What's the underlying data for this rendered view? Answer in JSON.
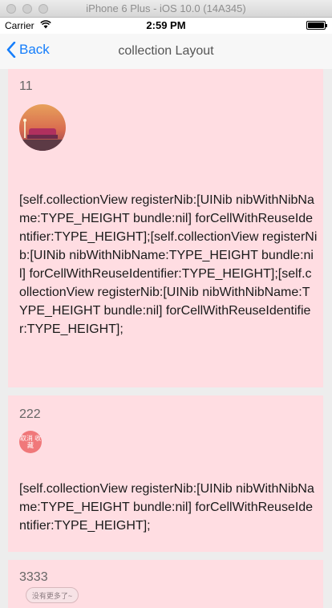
{
  "simulator": {
    "title": "iPhone 6 Plus - iOS 10.0 (14A345)"
  },
  "status_bar": {
    "carrier": "Carrier",
    "time": "2:59 PM",
    "battery_level": 1.0
  },
  "nav": {
    "back_label": "Back",
    "title": "collection Layout"
  },
  "cells": [
    {
      "number": "11",
      "text": "[self.collectionView registerNib:[UINib nibWithNibName:TYPE_HEIGHT bundle:nil] forCellWithReuseIdentifier:TYPE_HEIGHT];[self.collectionView registerNib:[UINib nibWithNibName:TYPE_HEIGHT bundle:nil] forCellWithReuseIdentifier:TYPE_HEIGHT];[self.collectionView registerNib:[UINib nibWithNibName:TYPE_HEIGHT bundle:nil] forCellWithReuseIdentifier:TYPE_HEIGHT];"
    },
    {
      "number": "222",
      "badge_text": "取消 收藏",
      "text": "[self.collectionView registerNib:[UINib nibWithNibName:TYPE_HEIGHT bundle:nil] forCellWithReuseIdentifier:TYPE_HEIGHT];"
    },
    {
      "number": "3333",
      "badge_text": "没有更多了~"
    }
  ],
  "colors": {
    "cell_bg": "#ffdde2",
    "accent": "#157efb",
    "badge_red": "#f0787a"
  }
}
